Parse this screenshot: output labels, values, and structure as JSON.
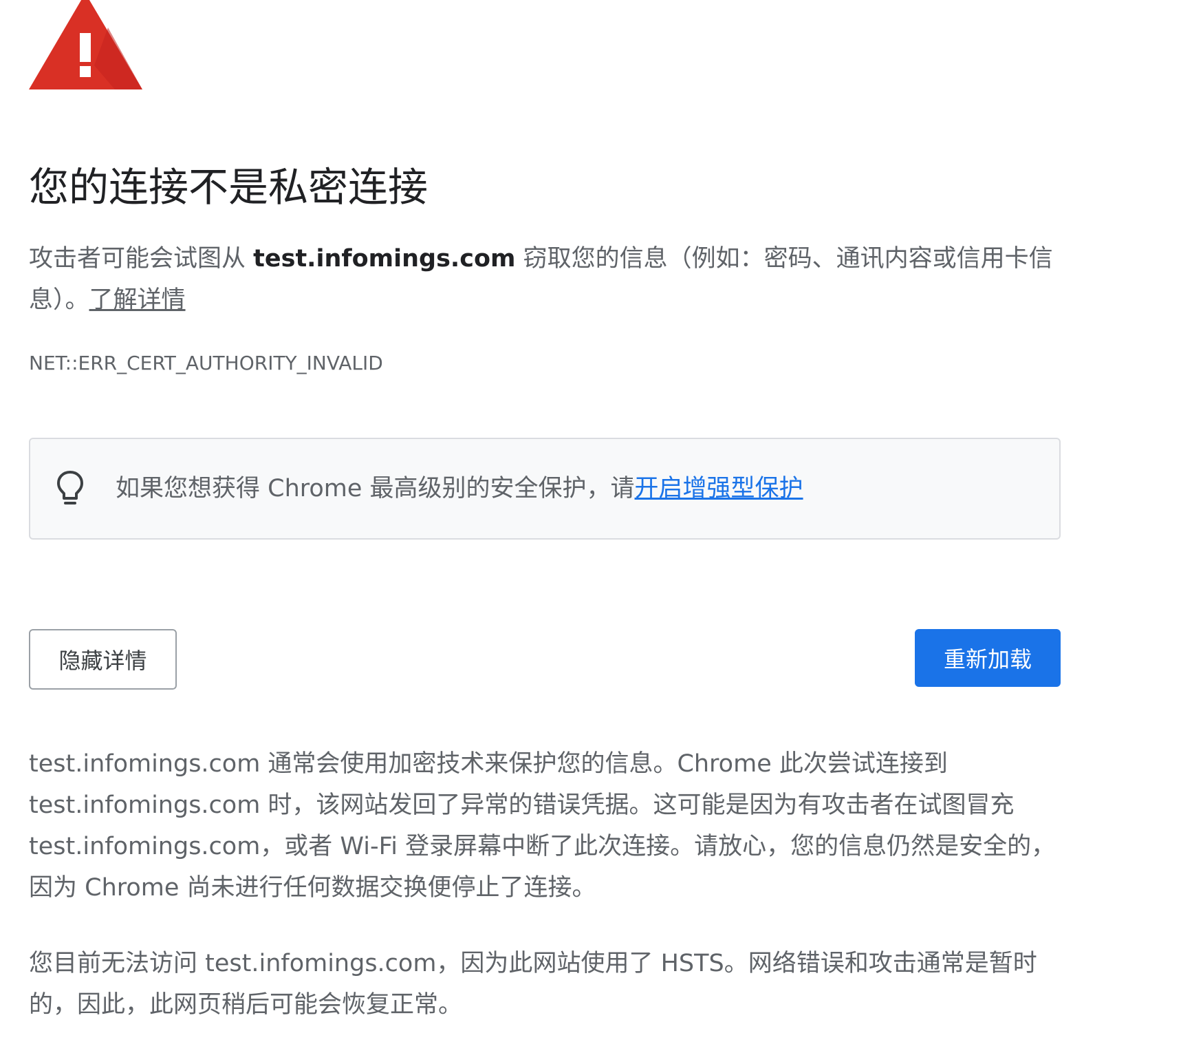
{
  "header": {
    "title": "您的连接不是私密连接"
  },
  "explanation": {
    "prefix": "攻击者可能会试图从 ",
    "domain": "test.infomings.com",
    "suffix": " 窃取您的信息（例如：密码、通讯内容或信用卡信息）。",
    "learn_more": "了解详情"
  },
  "error_code": "NET::ERR_CERT_AUTHORITY_INVALID",
  "promo": {
    "text": "如果您想获得 Chrome 最高级别的安全保护，请",
    "link": "开启增强型保护"
  },
  "buttons": {
    "hide_details": "隐藏详情",
    "reload": "重新加载"
  },
  "details": {
    "paragraph_1": "test.infomings.com 通常会使用加密技术来保护您的信息。Chrome 此次尝试连接到 test.infomings.com 时，该网站发回了异常的错误凭据。这可能是因为有攻击者在试图冒充 test.infomings.com，或者 Wi-Fi 登录屏幕中断了此次连接。请放心，您的信息仍然是安全的，因为 Chrome 尚未进行任何数据交换便停止了连接。",
    "paragraph_2": "您目前无法访问 test.infomings.com，因为此网站使用了 HSTS。网络错误和攻击通常是暂时的，因此，此网页稍后可能会恢复正常。"
  },
  "icons": {
    "warning": "warning-triangle-icon",
    "promo": "lightbulb-icon"
  },
  "colors": {
    "warning_red": "#d93025",
    "primary_blue": "#1a73e8",
    "text_secondary": "#5f6368",
    "promo_background": "#f8f9fa"
  }
}
